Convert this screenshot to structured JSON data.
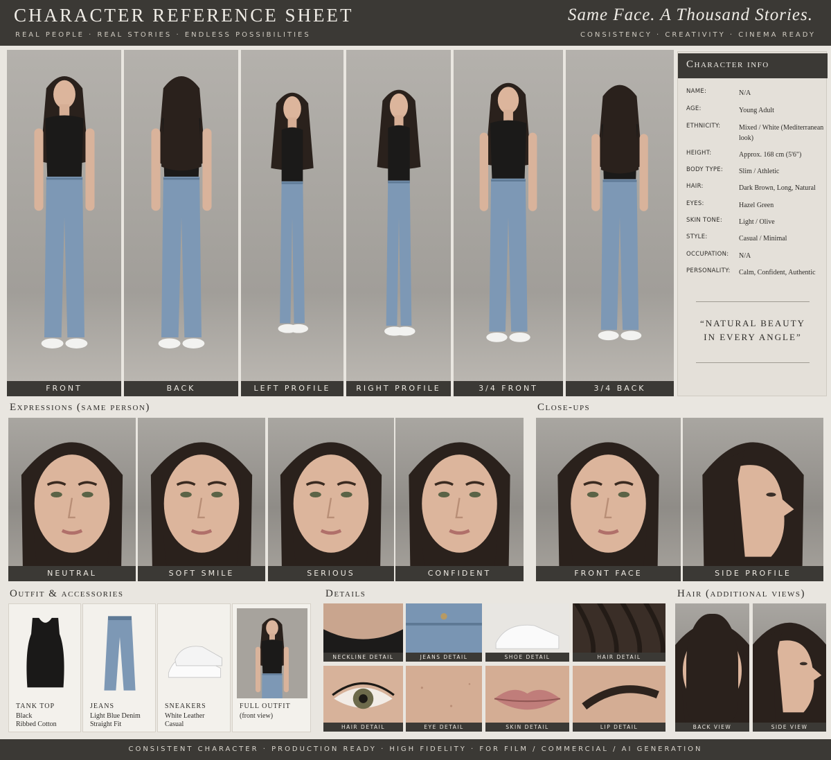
{
  "header": {
    "title": "CHARACTER REFERENCE SHEET",
    "subtitle": "REAL PEOPLE  ·  REAL STORIES  ·  ENDLESS POSSIBILITIES",
    "tagline": "Same Face. A Thousand Stories.",
    "tagline_sub": "CONSISTENCY  ·  CREATIVITY  ·  CINEMA READY"
  },
  "turnaround": [
    "FRONT",
    "BACK",
    "LEFT PROFILE",
    "RIGHT PROFILE",
    "3/4 FRONT",
    "3/4 BACK"
  ],
  "info": {
    "title": "Character info",
    "rows": [
      {
        "k": "NAME:",
        "v": "N/A"
      },
      {
        "k": "AGE:",
        "v": "Young Adult"
      },
      {
        "k": "ETHNICITY:",
        "v": "Mixed / White (Mediterranean look)"
      },
      {
        "k": "HEIGHT:",
        "v": "Approx. 168 cm (5'6\")"
      },
      {
        "k": "BODY TYPE:",
        "v": "Slim / Athletic"
      },
      {
        "k": "HAIR:",
        "v": "Dark Brown, Long, Natural"
      },
      {
        "k": "EYES:",
        "v": "Hazel Green"
      },
      {
        "k": "SKIN TONE:",
        "v": "Light / Olive"
      },
      {
        "k": "STYLE:",
        "v": "Casual / Minimal"
      },
      {
        "k": "OCCUPATION:",
        "v": "N/A"
      },
      {
        "k": "PERSONALITY:",
        "v": "Calm, Confident, Authentic"
      }
    ],
    "quote_line1": "“NATURAL BEAUTY",
    "quote_line2": "IN EVERY ANGLE”"
  },
  "expressions": {
    "title": "Expressions (same person)",
    "items": [
      "NEUTRAL",
      "SOFT SMILE",
      "SERIOUS",
      "CONFIDENT"
    ]
  },
  "closeups": {
    "title": "Close-ups",
    "items": [
      "FRONT FACE",
      "SIDE PROFILE"
    ]
  },
  "outfit": {
    "title": "Outfit & accessories",
    "items": [
      {
        "name": "TANK TOP",
        "l1": "Black",
        "l2": "Ribbed Cotton"
      },
      {
        "name": "JEANS",
        "l1": "Light Blue Denim",
        "l2": "Straight Fit"
      },
      {
        "name": "SNEAKERS",
        "l1": "White Leather",
        "l2": "Casual"
      },
      {
        "name": "FULL OUTFIT",
        "l1": "(front view)",
        "l2": ""
      }
    ]
  },
  "details": {
    "title": "Details",
    "row1": [
      "NECKLINE DETAIL",
      "JEANS DETAIL",
      "SHOE DETAIL",
      "HAIR DETAIL"
    ],
    "row2": [
      "HAIR DETAIL",
      "EYE DETAIL",
      "SKIN DETAIL",
      "LIP DETAIL"
    ]
  },
  "hair": {
    "title": "Hair (additional views)",
    "items": [
      "BACK VIEW",
      "SIDE VIEW"
    ]
  },
  "footer": "CONSISTENT CHARACTER  ·  PRODUCTION READY  ·  HIGH FIDELITY  ·  FOR FILM / COMMERCIAL / AI GENERATION"
}
